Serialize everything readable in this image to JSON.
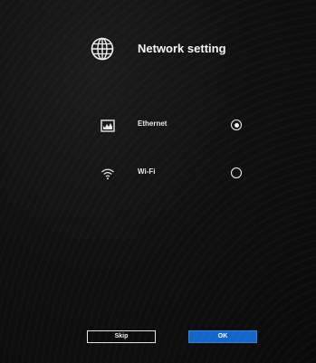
{
  "header": {
    "title": "Network setting",
    "icon": "globe-icon"
  },
  "options": [
    {
      "label": "Ethernet",
      "icon": "ethernet-icon",
      "selected": true
    },
    {
      "label": "Wi-Fi",
      "icon": "wifi-icon",
      "selected": false
    }
  ],
  "buttons": {
    "skip_label": "Skip",
    "ok_label": "OK"
  },
  "colors": {
    "background": "#0d0d0d",
    "accent": "#1565c8",
    "text": "#f2f2f2"
  }
}
